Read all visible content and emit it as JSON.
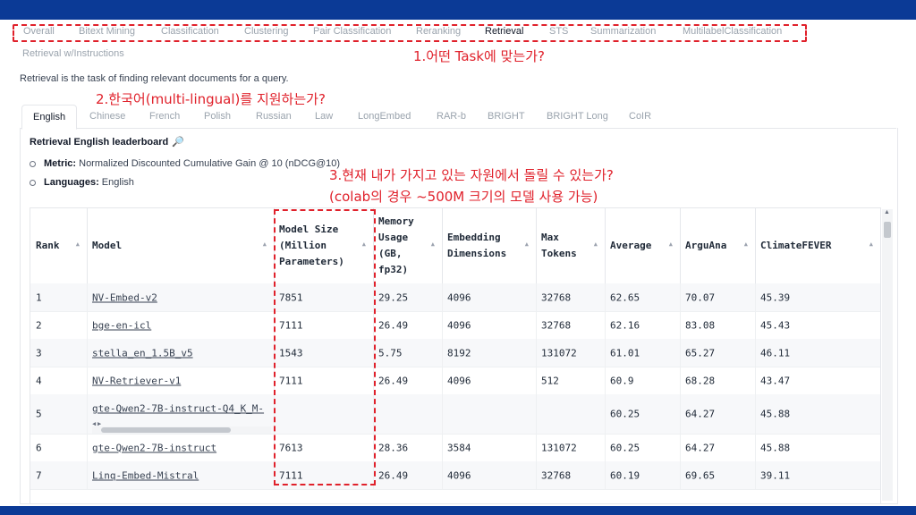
{
  "top_tabs": [
    {
      "label": "Overall"
    },
    {
      "label": "Bitext Mining"
    },
    {
      "label": "Classification"
    },
    {
      "label": "Clustering"
    },
    {
      "label": "Pair Classification"
    },
    {
      "label": "Reranking"
    },
    {
      "label": "Retrieval",
      "active": true
    },
    {
      "label": "STS"
    },
    {
      "label": "Summarization"
    },
    {
      "label": "MultilabelClassification"
    }
  ],
  "top_tabs_row2": {
    "label": "Retrieval w/Instructions"
  },
  "description": "Retrieval is the task of finding relevant documents for a query.",
  "annotations": {
    "q1": "1.어떤 Task에 맞는가?",
    "q2": "2.한국어(multi-lingual)를 지원하는가?",
    "q3_line1": "3.현재 내가 가지고 있는 자원에서 돌릴 수 있는가?",
    "q3_line2": "(colab의 경우 ~500M 크기의 모델 사용 가능)"
  },
  "lang_tabs": [
    "English",
    "Chinese",
    "French",
    "Polish",
    "Russian",
    "Law",
    "LongEmbed",
    "RAR-b",
    "BRIGHT",
    "BRIGHT Long",
    "CoIR"
  ],
  "leaderboard": {
    "title": "Retrieval English leaderboard",
    "icon": "magnifier-icon",
    "metric_label": "Metric:",
    "metric_value": "Normalized Discounted Cumulative Gain @ 10 (nDCG@10)",
    "languages_label": "Languages:",
    "languages_value": "English"
  },
  "table": {
    "columns": [
      "Rank",
      "Model",
      "Model Size\n(Million\nParameters)",
      "Memory\nUsage\n(GB,\nfp32)",
      "Embedding\nDimensions",
      "Max\nTokens",
      "Average",
      "ArguAna",
      "ClimateFEVER"
    ],
    "rows": [
      {
        "rank": "1",
        "model": "NV-Embed-v2",
        "size": "7851",
        "mem": "29.25",
        "emb": "4096",
        "max": "32768",
        "avg": "62.65",
        "argu": "70.07",
        "climate": "45.39"
      },
      {
        "rank": "2",
        "model": "bge-en-icl",
        "size": "7111",
        "mem": "26.49",
        "emb": "4096",
        "max": "32768",
        "avg": "62.16",
        "argu": "83.08",
        "climate": "45.43"
      },
      {
        "rank": "3",
        "model": "stella_en_1.5B_v5",
        "size": "1543",
        "mem": "5.75",
        "emb": "8192",
        "max": "131072",
        "avg": "61.01",
        "argu": "65.27",
        "climate": "46.11"
      },
      {
        "rank": "4",
        "model": "NV-Retriever-v1",
        "size": "7111",
        "mem": "26.49",
        "emb": "4096",
        "max": "512",
        "avg": "60.9",
        "argu": "68.28",
        "climate": "43.47"
      },
      {
        "rank": "5",
        "model": "gte-Qwen2-7B-instruct-Q4_K_M-",
        "size": "",
        "mem": "",
        "emb": "",
        "max": "",
        "avg": "60.25",
        "argu": "64.27",
        "climate": "45.88"
      },
      {
        "rank": "6",
        "model": "gte-Qwen2-7B-instruct",
        "size": "7613",
        "mem": "28.36",
        "emb": "3584",
        "max": "131072",
        "avg": "60.25",
        "argu": "64.27",
        "climate": "45.88"
      },
      {
        "rank": "7",
        "model": "Linq-Embed-Mistral",
        "size": "7111",
        "mem": "26.49",
        "emb": "4096",
        "max": "32768",
        "avg": "60.19",
        "argu": "69.65",
        "climate": "39.11"
      }
    ]
  },
  "colors": {
    "accent_red": "#e0212b",
    "brand_blue": "#0b3a96"
  }
}
